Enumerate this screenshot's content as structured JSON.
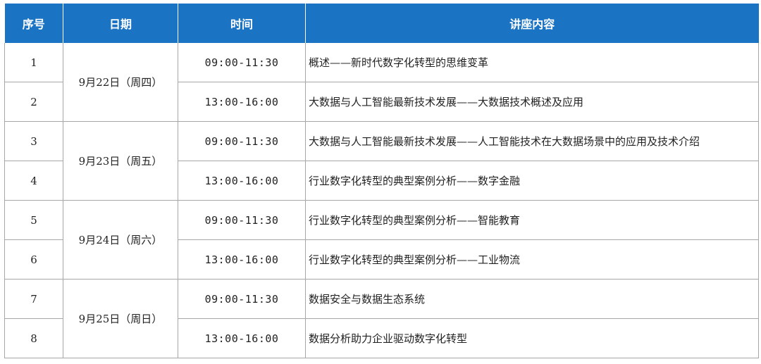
{
  "table": {
    "headers": {
      "seq": "序号",
      "date": "日期",
      "time": "时间",
      "topic": "讲座内容"
    },
    "days": [
      {
        "date": "9月22日（周四）",
        "sessions": [
          {
            "seq": "1",
            "time": "09:00-11:30",
            "topic": "概述——新时代数字化转型的思维变革"
          },
          {
            "seq": "2",
            "time": "13:00-16:00",
            "topic": "大数据与人工智能最新技术发展——大数据技术概述及应用"
          }
        ]
      },
      {
        "date": "9月23日（周五）",
        "sessions": [
          {
            "seq": "3",
            "time": "09:00-11:30",
            "topic": "大数据与人工智能最新技术发展——人工智能技术在大数据场景中的应用及技术介绍"
          },
          {
            "seq": "4",
            "time": "13:00-16:00",
            "topic": "行业数字化转型的典型案例分析——数字金融"
          }
        ]
      },
      {
        "date": "9月24日（周六）",
        "sessions": [
          {
            "seq": "5",
            "time": "09:00-11:30",
            "topic": "行业数字化转型的典型案例分析——智能教育"
          },
          {
            "seq": "6",
            "time": "13:00-16:00",
            "topic": "行业数字化转型的典型案例分析——工业物流"
          }
        ]
      },
      {
        "date": "9月25日（周日）",
        "sessions": [
          {
            "seq": "7",
            "time": "09:00-11:30",
            "topic": "数据安全与数据生态系统"
          },
          {
            "seq": "8",
            "time": "13:00-16:00",
            "topic": "数据分析助力企业驱动数字化转型"
          }
        ]
      }
    ],
    "colors": {
      "header_bg": "#1a73c3",
      "header_text": "#ffffff",
      "grid": "#a7a7a7"
    }
  }
}
